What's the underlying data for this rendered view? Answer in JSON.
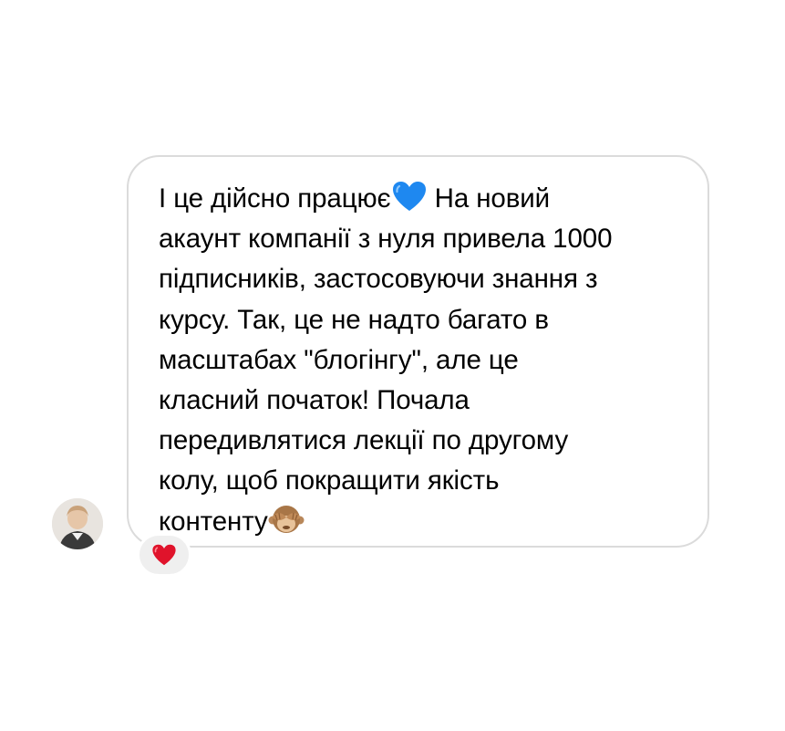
{
  "message": {
    "lines": [
      "І це дійсно працює",
      " На новий",
      "акаунт компанії з нуля привела 1000",
      "підписників, застосовуючи знання з",
      "курсу. Так, це не надто багато в",
      "масштабах \"блогінгу\", але це",
      "класний початок! Почала",
      "передивлятися лекції по другому",
      "колу, щоб покращити якість",
      "контенту"
    ],
    "inline_emojis": [
      "blue-heart",
      "see-no-evil-monkey"
    ]
  },
  "reaction": {
    "emoji": "red-heart"
  },
  "avatar": {
    "icon": "user-avatar"
  }
}
